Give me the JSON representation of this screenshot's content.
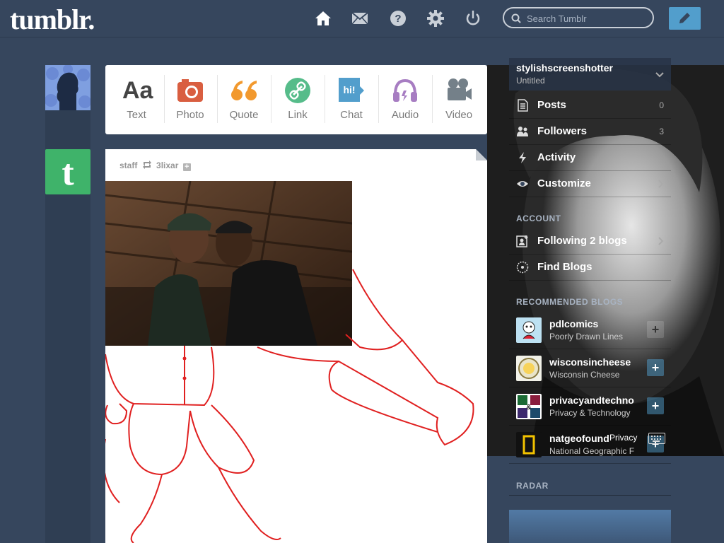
{
  "header": {
    "logo": "tumblr.",
    "search_placeholder": "Search Tumblr"
  },
  "post_types": [
    {
      "label": "Text",
      "icon": "text-icon",
      "color": "#444444"
    },
    {
      "label": "Photo",
      "icon": "camera-icon",
      "color": "#d95e40"
    },
    {
      "label": "Quote",
      "icon": "quote-icon",
      "color": "#f2992e"
    },
    {
      "label": "Link",
      "icon": "link-icon",
      "color": "#56bc8a"
    },
    {
      "label": "Chat",
      "icon": "chat-icon",
      "color": "#529ecc"
    },
    {
      "label": "Audio",
      "icon": "headphones-icon",
      "color": "#a77dc2"
    },
    {
      "label": "Video",
      "icon": "video-camera-icon",
      "color": "#748089"
    }
  ],
  "post": {
    "author": "staff",
    "reblogged_from": "3lixar"
  },
  "sidebar": {
    "blog_name": "stylishscreenshotter",
    "blog_subtitle": "Untitled",
    "items": [
      {
        "label": "Posts",
        "count": "0"
      },
      {
        "label": "Followers",
        "count": "3"
      },
      {
        "label": "Activity",
        "count": ""
      },
      {
        "label": "Customize",
        "count": ""
      }
    ],
    "account_heading": "ACCOUNT",
    "account_items": [
      {
        "label": "Following 2 blogs"
      },
      {
        "label": "Find Blogs"
      }
    ],
    "recommended_heading": "RECOMMENDED BLOGS",
    "recommended": [
      {
        "name": "pdlcomics",
        "subtitle": "Poorly Drawn Lines"
      },
      {
        "name": "wisconsincheese",
        "subtitle": "Wisconsin Cheese"
      },
      {
        "name": "privacyandtechnology",
        "subtitle": "Privacy & Technology"
      },
      {
        "name": "natgeofound",
        "subtitle": "National Geographic Found"
      }
    ],
    "privacy": "Privacy",
    "radar_heading": "RADAR"
  }
}
